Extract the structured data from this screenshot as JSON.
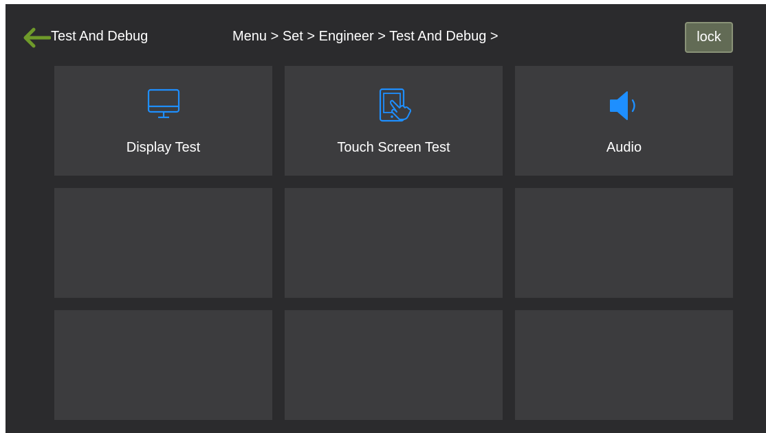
{
  "header": {
    "title": "Test And Debug",
    "back_icon": "arrow-left-icon",
    "breadcrumb": [
      "Menu >",
      "Set >",
      "Engineer >",
      "Test And Debug >"
    ],
    "lock_label": "lock"
  },
  "tiles": [
    {
      "label": "Display Test",
      "icon": "monitor-icon"
    },
    {
      "label": "Touch Screen Test",
      "icon": "touch-tablet-icon"
    },
    {
      "label": "Audio",
      "icon": "speaker-icon"
    },
    {
      "label": "",
      "icon": ""
    },
    {
      "label": "",
      "icon": ""
    },
    {
      "label": "",
      "icon": ""
    },
    {
      "label": "",
      "icon": ""
    },
    {
      "label": "",
      "icon": ""
    },
    {
      "label": "",
      "icon": ""
    }
  ],
  "colors": {
    "background": "#2b2b2d",
    "tile": "#3c3c3e",
    "accent_blue": "#1e8fff",
    "back_arrow": "#6f9a2a",
    "lock_button": "#626b55"
  }
}
